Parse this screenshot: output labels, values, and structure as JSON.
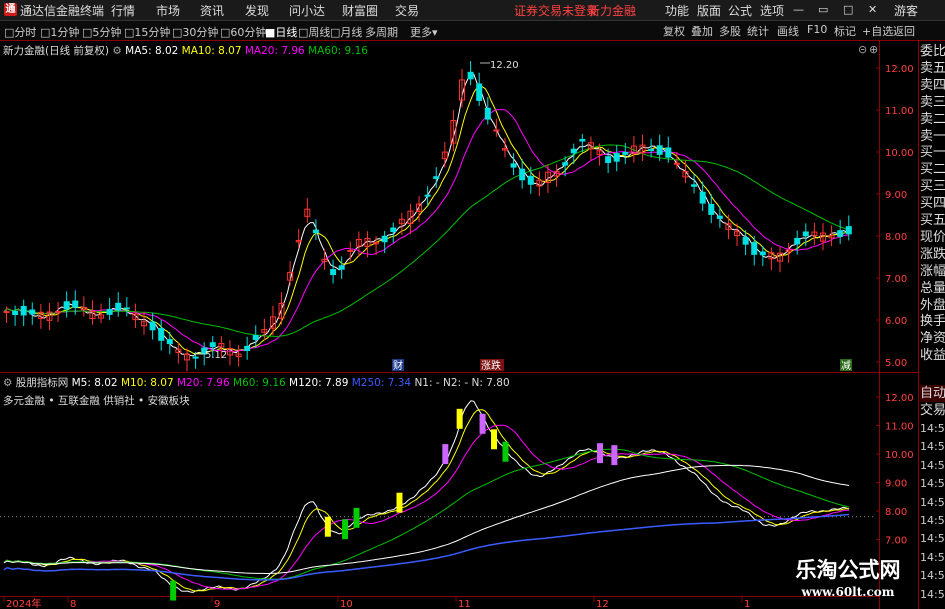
{
  "titlebar": {
    "app_name": "通达信金融终端",
    "menus": [
      "行情",
      "市场",
      "资讯",
      "发现",
      "问小达",
      "财富圈",
      "交易"
    ],
    "notice": "证券交易未登录",
    "stock": "新力金融",
    "right_menus": [
      "功能",
      "版面",
      "公式",
      "选项"
    ],
    "guest": "游客"
  },
  "toolbar": {
    "periods": [
      "分时",
      "1分钟",
      "5分钟",
      "15分钟",
      "30分钟",
      "60分钟",
      "日线",
      "周线",
      "月线",
      "多周期",
      "更多"
    ],
    "active": "日线",
    "right_buttons": [
      "复权",
      "叠加",
      "多股",
      "统计",
      "画线",
      "F10",
      "标记",
      "+自选",
      "返回"
    ]
  },
  "main_legend": {
    "title": "新力金融(日线 前复权)",
    "ma5": "MA5: 8.02",
    "ma10": "MA10: 8.07",
    "ma20": "MA20: 7.96",
    "ma60": "MA60: 9.16"
  },
  "sub_legend": {
    "title": "股朋指标网",
    "m5": "M5: 8.02",
    "m10": "M10: 8.07",
    "m20": "M20: 7.96",
    "m60": "M60: 9.16",
    "m120": "M120: 7.89",
    "m250": "M250: 7.34",
    "n1": "N1: -",
    "n2": "N2: -",
    "n": "N: 7.80"
  },
  "concepts": "多元金融 • 互联金融 供销社 • 安徽板块",
  "annotations": {
    "high": "12.20",
    "low": "5.12",
    "marker_cai": "财",
    "marker_kuai": "涨跌",
    "marker_jian": "减"
  },
  "main_axis": [
    "12.00",
    "11.00",
    "10.00",
    "9.00",
    "8.00",
    "7.00",
    "6.00",
    "5.00"
  ],
  "sub_axis": [
    "12.00",
    "11.00",
    "10.00",
    "9.00",
    "8.00",
    "7.00"
  ],
  "date_axis": [
    "2024年",
    "8",
    "9",
    "10",
    "11",
    "12",
    "1"
  ],
  "side_panel": {
    "items": [
      "委比",
      "卖五",
      "卖四",
      "卖三",
      "卖二",
      "卖一",
      "买一",
      "买二",
      "买三",
      "买四",
      "买五",
      "现价",
      "涨跌",
      "涨幅",
      "总量",
      "外盘",
      "换手",
      "净资",
      "收益"
    ],
    "tabs": [
      "自动",
      "交易"
    ],
    "times": [
      "14:56",
      "14:56",
      "14:56",
      "14:56",
      "14:56",
      "14:56",
      "14:56",
      "14:56",
      "14:56",
      "14:56"
    ]
  },
  "watermark": {
    "title": "乐淘公式网",
    "url": "www.60lt.com"
  },
  "colors": {
    "up": "#ff3232",
    "down": "#00e0e0",
    "ma5": "#ffffff",
    "ma10": "#ffff00",
    "ma20": "#ff00ff",
    "ma60": "#00c000",
    "m120": "#ffffff",
    "m250": "#3a5cff"
  }
}
